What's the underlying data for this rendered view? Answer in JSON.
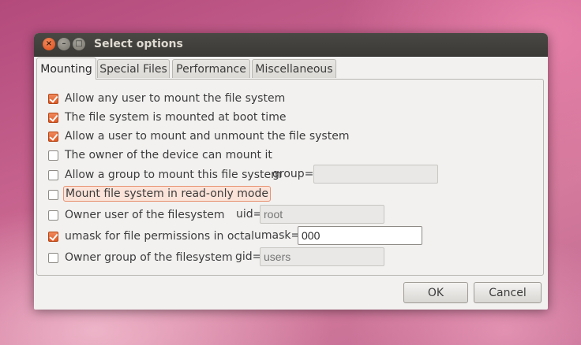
{
  "window": {
    "title": "Select options"
  },
  "tabs": [
    {
      "label": "Mounting",
      "active": true
    },
    {
      "label": "Special Files",
      "active": false
    },
    {
      "label": "Performance",
      "active": false
    },
    {
      "label": "Miscellaneous",
      "active": false
    }
  ],
  "options": [
    {
      "label": "Allow any user to mount the file system",
      "checked": true
    },
    {
      "label": "The file system is mounted at boot time",
      "checked": true
    },
    {
      "label": "Allow a user to mount and unmount the file system",
      "checked": true
    },
    {
      "label": "The owner of the device can mount it",
      "checked": false
    },
    {
      "label": "Allow a group to mount this file system",
      "checked": false,
      "field_label": "group=",
      "value": "",
      "placeholder": ""
    },
    {
      "label": "Mount file system in read-only mode",
      "checked": false
    },
    {
      "label": "Owner user of the filesystem",
      "checked": false,
      "field_label": "uid=",
      "value": "",
      "placeholder": "root"
    },
    {
      "label": "umask for file permissions in octal",
      "checked": true,
      "field_label": "umask=",
      "value": "000",
      "placeholder": ""
    },
    {
      "label": "Owner group of the filesystem",
      "checked": false,
      "field_label": "gid=",
      "value": "",
      "placeholder": "users"
    }
  ],
  "buttons": {
    "ok": "OK",
    "cancel": "Cancel"
  },
  "colors": {
    "accent": "#dd5a27",
    "titlebar": "#3b3a36",
    "window_bg": "#f2f1f0"
  }
}
